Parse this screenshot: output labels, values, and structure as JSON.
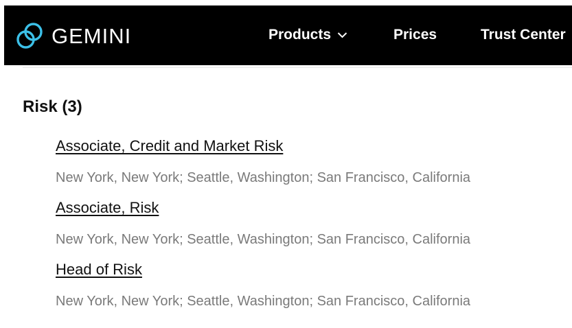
{
  "header": {
    "brand": "GEMINI",
    "logo_icon": "gemini-logo-icon",
    "nav": {
      "products": "Products",
      "prices": "Prices",
      "trust_center": "Trust Center"
    },
    "accent_color": "#3cc0e8",
    "background_color": "#000000"
  },
  "section": {
    "heading": "Risk (3)",
    "jobs": [
      {
        "title": "Associate, Credit and Market Risk",
        "location": "New York, New York; Seattle, Washington; San Francisco, California"
      },
      {
        "title": "Associate, Risk",
        "location": "New York, New York; Seattle, Washington; San Francisco, California"
      },
      {
        "title": "Head of Risk",
        "location": "New York, New York; Seattle, Washington; San Francisco, California"
      }
    ]
  }
}
